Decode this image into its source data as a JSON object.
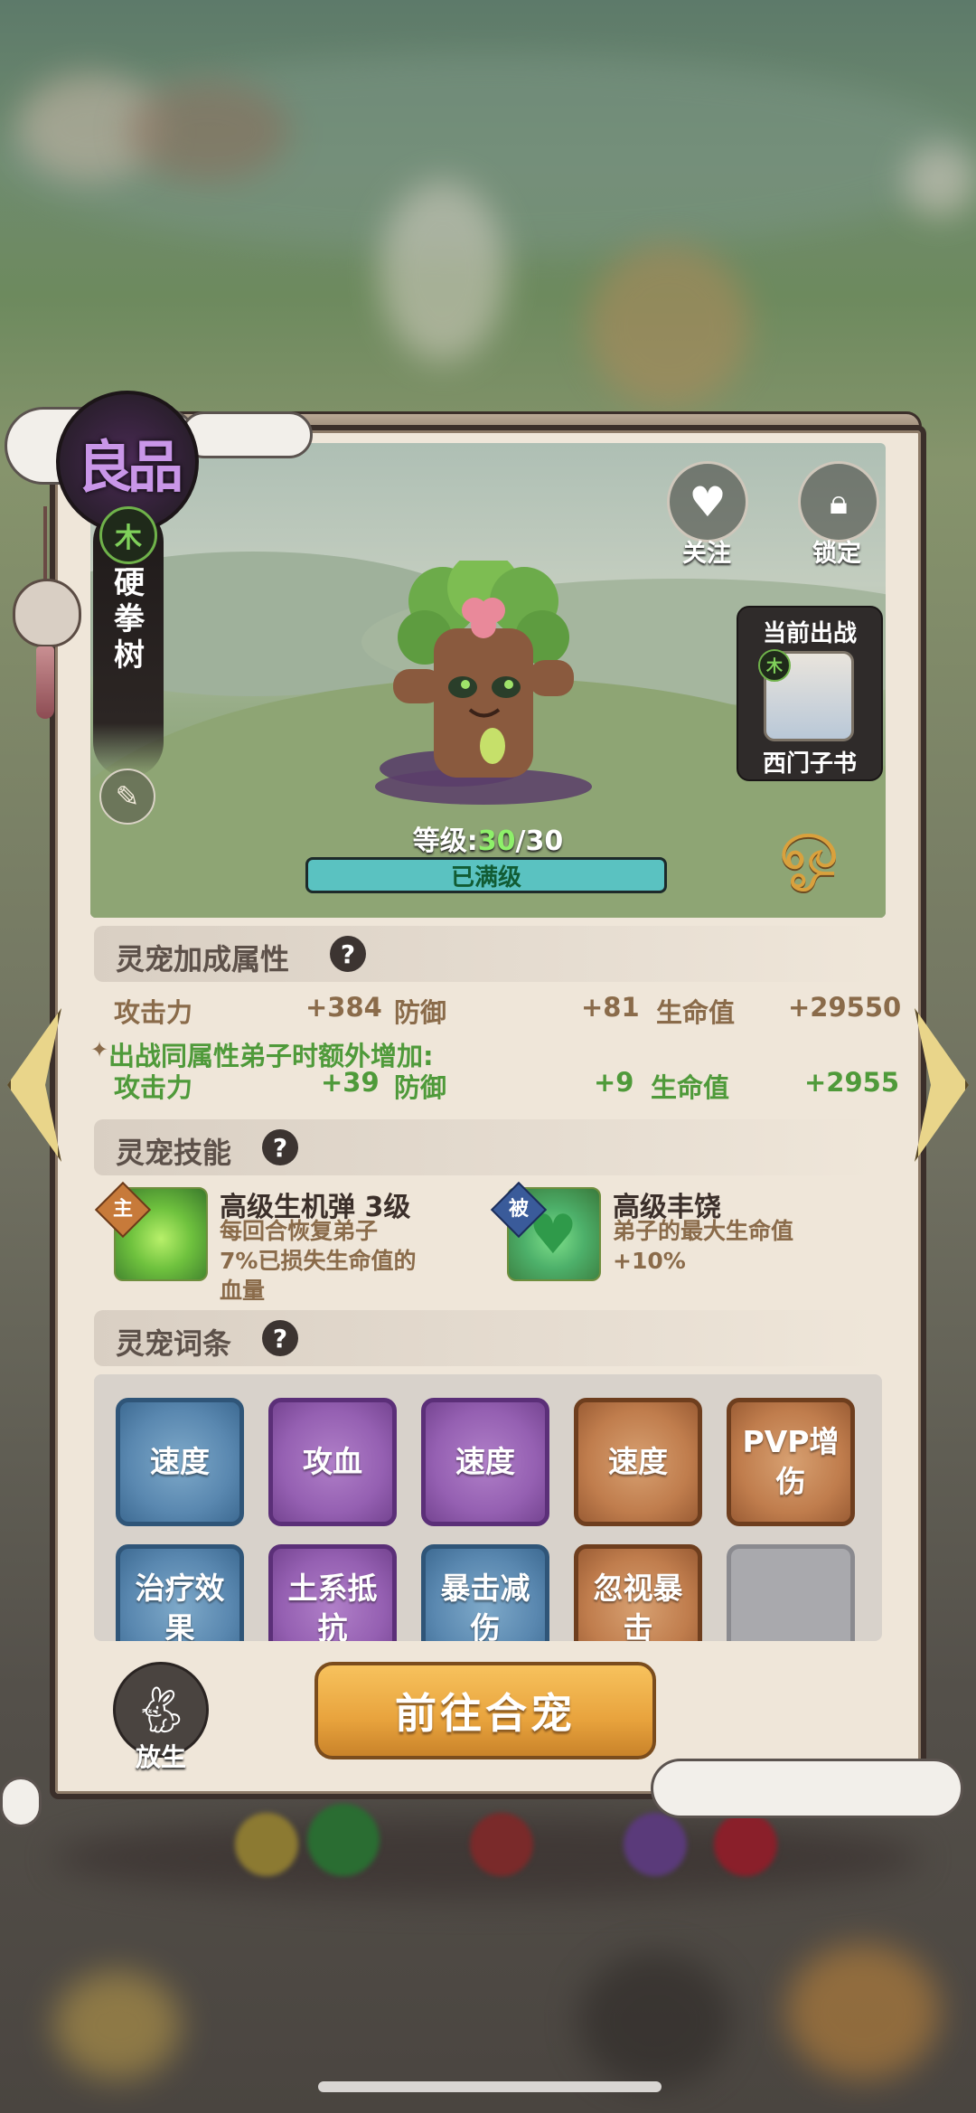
{
  "pet": {
    "quality": "良品",
    "element": "木",
    "name": "硬拳树",
    "level_label": "等级:",
    "level_current": "30",
    "level_sep": "/",
    "level_max": "30",
    "level_progress": 1.0,
    "status": "已满级"
  },
  "actions": {
    "follow_label": "关注",
    "lock_label": "锁定",
    "release_label": "放生",
    "go_merge_label": "前往合宠"
  },
  "deployed": {
    "title": "当前出战",
    "element": "木",
    "name": "西门子书"
  },
  "attributes": {
    "title": "灵宠加成属性",
    "help": "?",
    "base": [
      {
        "label": "攻击力",
        "value": "+384"
      },
      {
        "label": "防御",
        "value": "+81"
      },
      {
        "label": "生命值",
        "value": "+29550"
      }
    ],
    "bonus_title": "出战同属性弟子时额外增加:",
    "bonus": [
      {
        "label": "攻击力",
        "value": "+39"
      },
      {
        "label": "防御",
        "value": "+9"
      },
      {
        "label": "生命值",
        "value": "+2955"
      }
    ]
  },
  "skills": {
    "title": "灵宠技能",
    "help": "?",
    "items": [
      {
        "badge": "主",
        "name": "高级生机弹 3级",
        "desc_lines": [
          "每回合恢复弟子",
          "7%已损失生命值的",
          "血量"
        ]
      },
      {
        "badge": "被",
        "name": "高级丰饶",
        "desc_lines": [
          "弟子的最大生命值",
          "+10%"
        ]
      }
    ]
  },
  "traits": {
    "title": "灵宠词条",
    "help": "?",
    "items": [
      {
        "label": "速度",
        "color": "blue"
      },
      {
        "label": "攻血",
        "color": "purple"
      },
      {
        "label": "速度",
        "color": "purple"
      },
      {
        "label": "速度",
        "color": "orange"
      },
      {
        "label": "PVP增伤",
        "color": "orange"
      },
      {
        "label": "治疗效果",
        "color": "blue"
      },
      {
        "label": "土系抵抗",
        "color": "purple"
      },
      {
        "label": "暴击减伤",
        "color": "blue"
      },
      {
        "label": "忽视暴击",
        "color": "orange"
      },
      {
        "label": "",
        "color": "empty"
      }
    ]
  },
  "colors": {
    "accent_green": "#4f9a3a",
    "level_bar": "#5ac2c1",
    "merge_button": "#e8a33d"
  }
}
